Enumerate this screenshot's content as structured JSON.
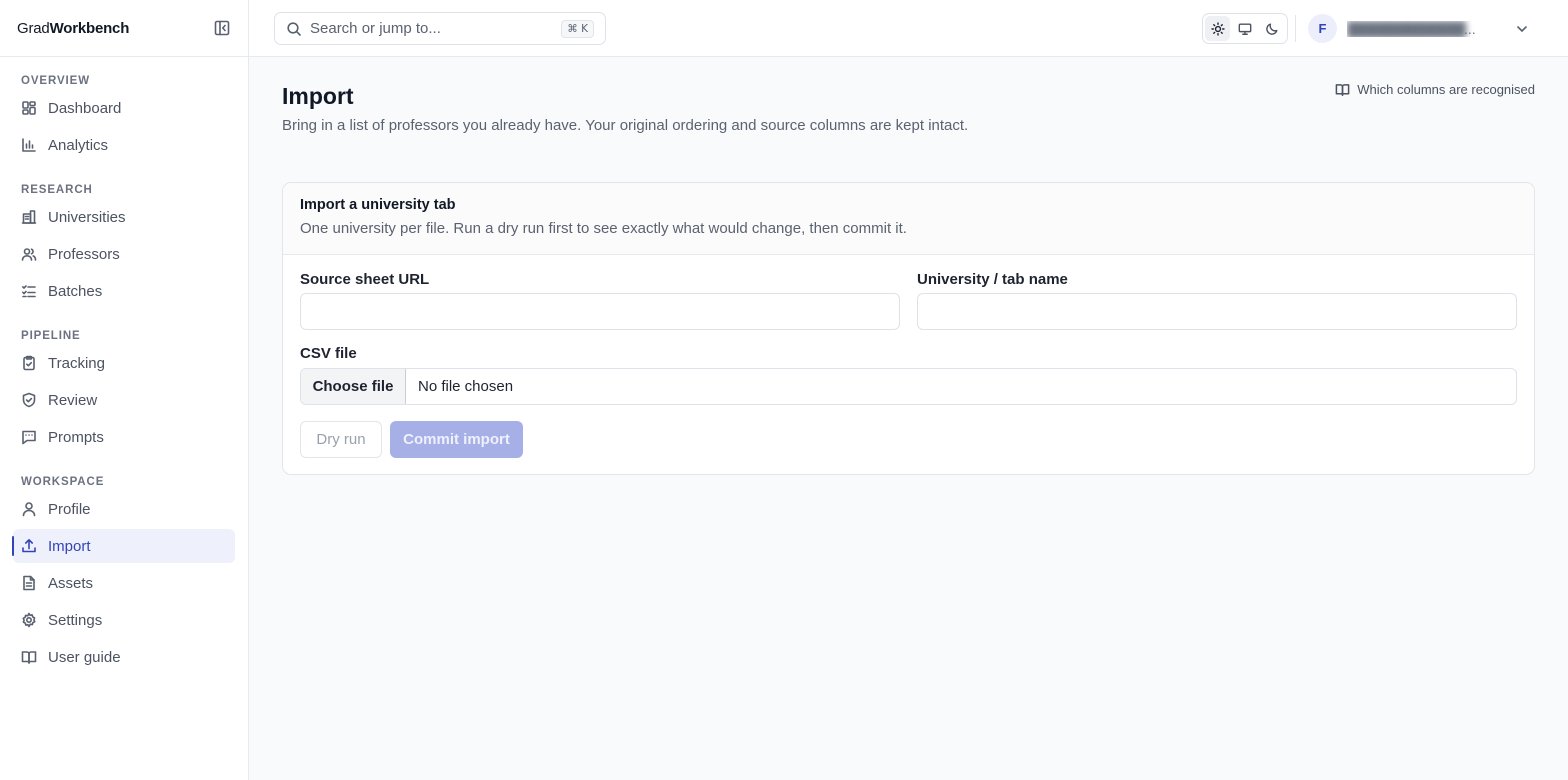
{
  "brand": {
    "prefix": "Grad",
    "bold": "Workbench"
  },
  "sidebar": {
    "sections": [
      {
        "label": "OVERVIEW",
        "items": [
          {
            "label": "Dashboard",
            "icon": "dashboard-icon"
          },
          {
            "label": "Analytics",
            "icon": "bar-chart-icon"
          }
        ]
      },
      {
        "label": "RESEARCH",
        "items": [
          {
            "label": "Universities",
            "icon": "building-icon"
          },
          {
            "label": "Professors",
            "icon": "users-icon"
          },
          {
            "label": "Batches",
            "icon": "checklist-icon"
          }
        ]
      },
      {
        "label": "PIPELINE",
        "items": [
          {
            "label": "Tracking",
            "icon": "clipboard-check-icon"
          },
          {
            "label": "Review",
            "icon": "shield-check-icon"
          },
          {
            "label": "Prompts",
            "icon": "message-square-icon"
          }
        ]
      },
      {
        "label": "WORKSPACE",
        "items": [
          {
            "label": "Profile",
            "icon": "user-icon"
          },
          {
            "label": "Import",
            "icon": "upload-icon",
            "active": true
          },
          {
            "label": "Assets",
            "icon": "file-text-icon"
          },
          {
            "label": "Settings",
            "icon": "gear-icon"
          },
          {
            "label": "User guide",
            "icon": "book-icon"
          }
        ]
      }
    ]
  },
  "topbar": {
    "search_placeholder": "Search or jump to...",
    "search_shortcut": "⌘ K",
    "theme_modes": [
      {
        "name": "light",
        "icon": "sun-icon",
        "active": true
      },
      {
        "name": "system",
        "icon": "monitor-icon",
        "active": false
      },
      {
        "name": "dark",
        "icon": "moon-icon",
        "active": false
      }
    ],
    "user": {
      "initial": "F",
      "email_ellipsis": "..."
    }
  },
  "page": {
    "title": "Import",
    "subtitle": "Bring in a list of professors you already have. Your original ordering and source columns are kept intact.",
    "help_link": "Which columns are recognised"
  },
  "card": {
    "title": "Import a university tab",
    "description": "One university per file. Run a dry run first to see exactly what would change, then commit it.",
    "source_url_label": "Source sheet URL",
    "source_url_value": "",
    "tab_name_label": "University / tab name",
    "tab_name_value": "",
    "csv_label": "CSV file",
    "choose_file_label": "Choose file",
    "no_file_text": "No file chosen",
    "dry_run_label": "Dry run",
    "commit_label": "Commit import"
  },
  "colors": {
    "accent": "#3245b8",
    "active_nav_bg": "#eef1fc",
    "commit_disabled_bg": "#a7b0e6"
  }
}
